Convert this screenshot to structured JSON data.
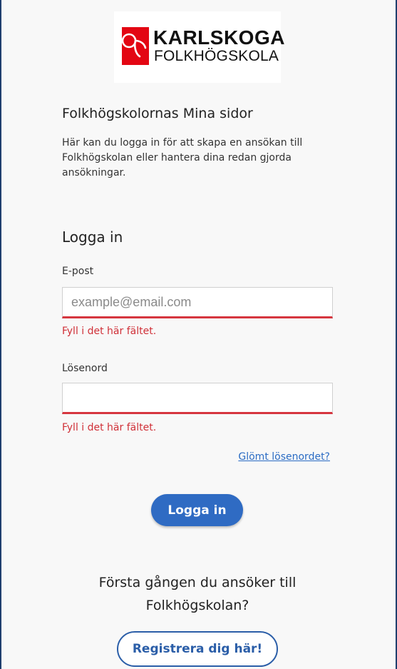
{
  "logo": {
    "line1": "KARLSKOGA",
    "line2": "FOLKHÖGSKOLA",
    "brand_color": "#e30613"
  },
  "header": {
    "title": "Folkhögskolornas Mina sidor",
    "intro": "Här kan du logga in för att skapa en ansökan till Folkhögskolan eller hantera dina redan gjorda ansökningar."
  },
  "login": {
    "heading": "Logga in",
    "email_label": "E-post",
    "email_placeholder": "example@email.com",
    "email_error": "Fyll i det här fältet.",
    "password_label": "Lösenord",
    "password_error": "Fyll i det här fältet.",
    "forgot_link": "Glömt lösenordet?",
    "submit_label": "Logga in"
  },
  "register": {
    "prompt": "Första gången du ansöker till Folkhögskolan?",
    "button_label": "Registrera dig här!"
  },
  "colors": {
    "accent": "#2f6bc3",
    "error": "#d03038",
    "frame_border": "#1f3f6e"
  }
}
